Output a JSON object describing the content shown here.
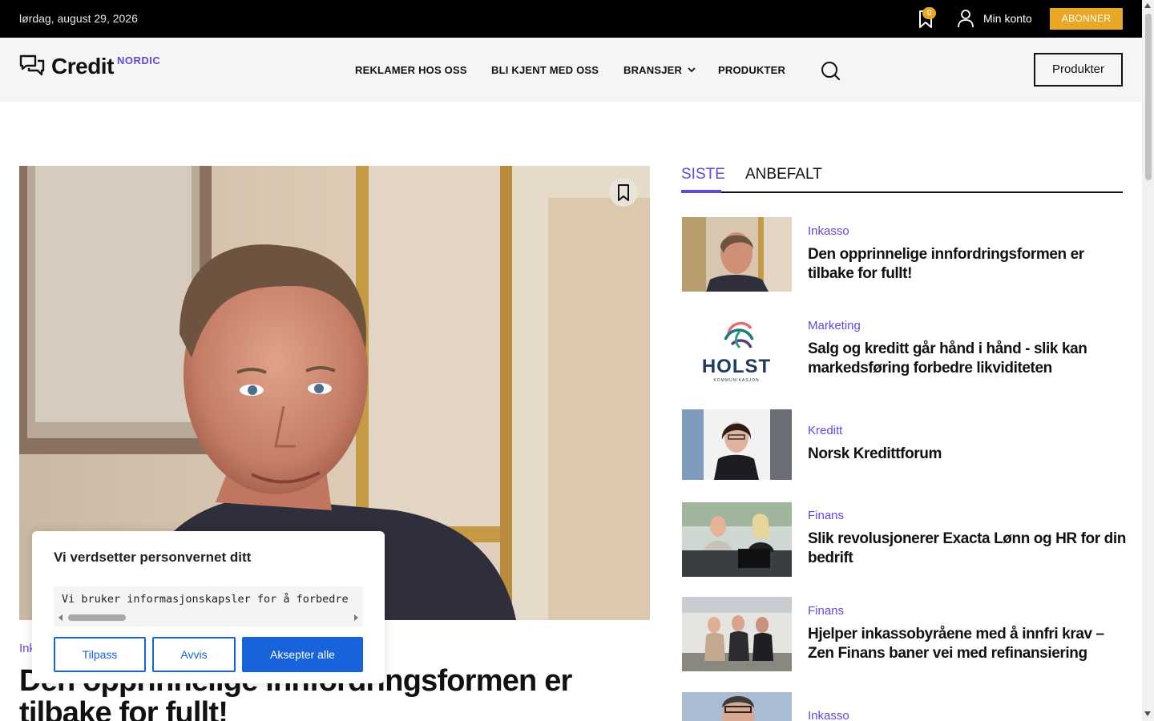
{
  "topbar": {
    "date": "lørdag, august 29, 2026",
    "bookmark_count": "0",
    "account_label": "Min konto",
    "subscribe_label": "ABONNER"
  },
  "header": {
    "logo_text": "Credit",
    "logo_sub": "NORDIC",
    "nav": [
      "REKLAMER HOS OSS",
      "BLI KJENT MED OSS",
      "BRANSJER",
      "PRODUKTER"
    ],
    "products_button": "Produkter"
  },
  "hero": {
    "category": "Inkasso",
    "title": "Den opprinnelige innfordringsformen er tilbake for fullt!"
  },
  "sidebar": {
    "tabs": [
      "SISTE",
      "ANBEFALT"
    ],
    "active_tab": "SISTE",
    "articles": [
      {
        "category": "Inkasso",
        "title": "Den opprinnelige innfordringsformen er tilbake for fullt!"
      },
      {
        "category": "Marketing",
        "title": "Salg og kreditt går hånd i hånd - slik kan markedsføring forbedre likviditeten"
      },
      {
        "category": "Kreditt",
        "title": "Norsk Kredittforum"
      },
      {
        "category": "Finans",
        "title": "Slik revolusjonerer Exacta Lønn og HR for din bedrift"
      },
      {
        "category": "Finans",
        "title": "Hjelper inkassobyråene med å innfri krav – Zen Finans baner vei med refinansiering"
      },
      {
        "category": "Inkasso",
        "title": ""
      }
    ],
    "logo_thumb_text": "HOLST",
    "logo_thumb_sub": "KOMMUNIKASJON"
  },
  "cookie": {
    "title": "Vi verdsetter personvernet ditt",
    "text": "Vi bruker informasjonskapsler for å forbedre",
    "customize": "Tilpass",
    "reject": "Avvis",
    "accept": "Aksepter alle"
  },
  "colors": {
    "accent": "#5b4bdb",
    "subscribe": "#e8a825",
    "cookie_blue": "#1863dc"
  }
}
